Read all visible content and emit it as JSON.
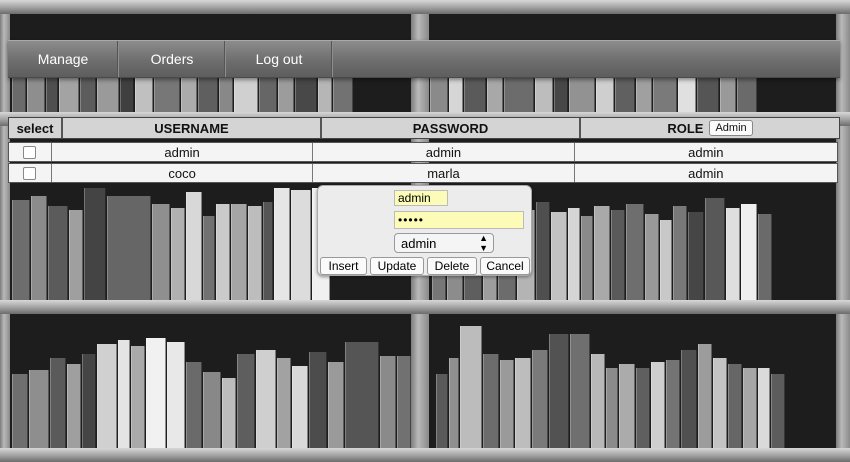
{
  "nav": {
    "manage": "Manage",
    "orders": "Orders",
    "logout": "Log out"
  },
  "table": {
    "headers": {
      "select": "select",
      "username": "USERNAME",
      "password": "PASSWORD",
      "role": "ROLE",
      "role_filter_button": "Admin"
    },
    "rows": [
      {
        "username": "admin",
        "password": "admin",
        "role": "admin"
      },
      {
        "username": "coco",
        "password": "marla",
        "role": "admin"
      }
    ]
  },
  "editor": {
    "username_value": "admin",
    "password_value": "•••••",
    "role_selected": "admin",
    "buttons": {
      "insert": "Insert",
      "update": "Update",
      "delete": "Delete",
      "cancel": "Cancel"
    }
  }
}
